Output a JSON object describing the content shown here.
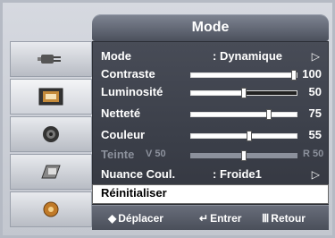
{
  "header": {
    "title": "Mode"
  },
  "sidebar": {
    "items": [
      {
        "icon": "plug-icon"
      },
      {
        "icon": "tv-screen-icon"
      },
      {
        "icon": "speaker-icon"
      },
      {
        "icon": "channel-icon"
      },
      {
        "icon": "gear-icon"
      }
    ]
  },
  "menu": {
    "mode": {
      "label": "Mode",
      "value": ": Dynamique",
      "arrow": "▷"
    },
    "contraste": {
      "label": "Contraste",
      "value": "100",
      "level": 1.0
    },
    "luminosite": {
      "label": "Luminosité",
      "value": "50",
      "level": 0.5
    },
    "nettete": {
      "label": "Netteté",
      "value": "75",
      "level": 0.75
    },
    "couleur": {
      "label": "Couleur",
      "value": "55",
      "level": 0.55
    },
    "teinte": {
      "label": "Teinte",
      "left": "V 50",
      "right": "R 50",
      "level": 0.5
    },
    "nuance": {
      "label": "Nuance Coul.",
      "value": ":   Froide1",
      "arrow": "▷"
    },
    "reset": {
      "label": "Réinitialiser"
    }
  },
  "footer": {
    "move": {
      "icon": "◆",
      "label": "Déplacer"
    },
    "enter": {
      "icon": "↵",
      "label": "Entrer"
    },
    "back": {
      "icon": "Ⅲ",
      "label": "Retour"
    }
  }
}
